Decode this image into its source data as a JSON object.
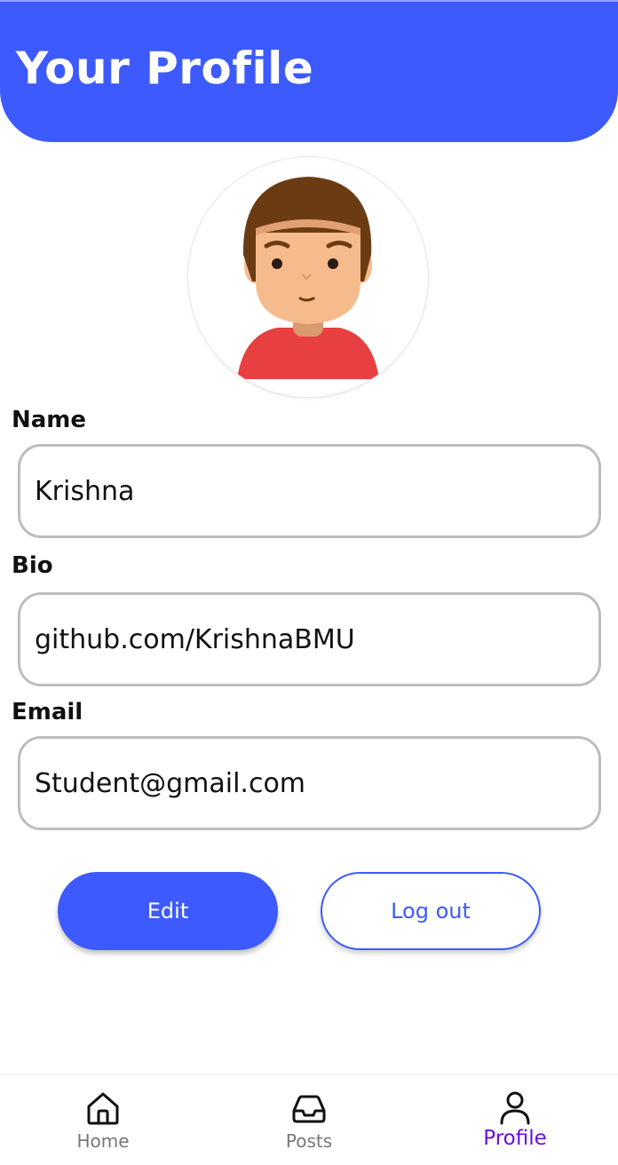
{
  "header": {
    "title": "Your Profile"
  },
  "profile": {
    "avatar": "cartoon-boy-avatar",
    "fields": {
      "name": {
        "label": "Name",
        "value": "Krishna"
      },
      "bio": {
        "label": "Bio",
        "value": "github.com/KrishnaBMU"
      },
      "email": {
        "label": "Email",
        "value": "Student@gmail.com"
      }
    }
  },
  "actions": {
    "edit_label": "Edit",
    "logout_label": "Log out"
  },
  "bottom_nav": {
    "items": [
      {
        "label": "Home",
        "icon": "home-icon"
      },
      {
        "label": "Posts",
        "icon": "inbox-icon"
      },
      {
        "label": "Profile",
        "icon": "person-icon",
        "active": true
      }
    ]
  },
  "colors": {
    "primary": "#3d5afe",
    "active_nav": "#6a0dde",
    "field_border": "#bdbdbd",
    "avatar_shirt": "#e84040",
    "avatar_hair": "#6b3c14",
    "avatar_skin": "#f6bb8c"
  }
}
